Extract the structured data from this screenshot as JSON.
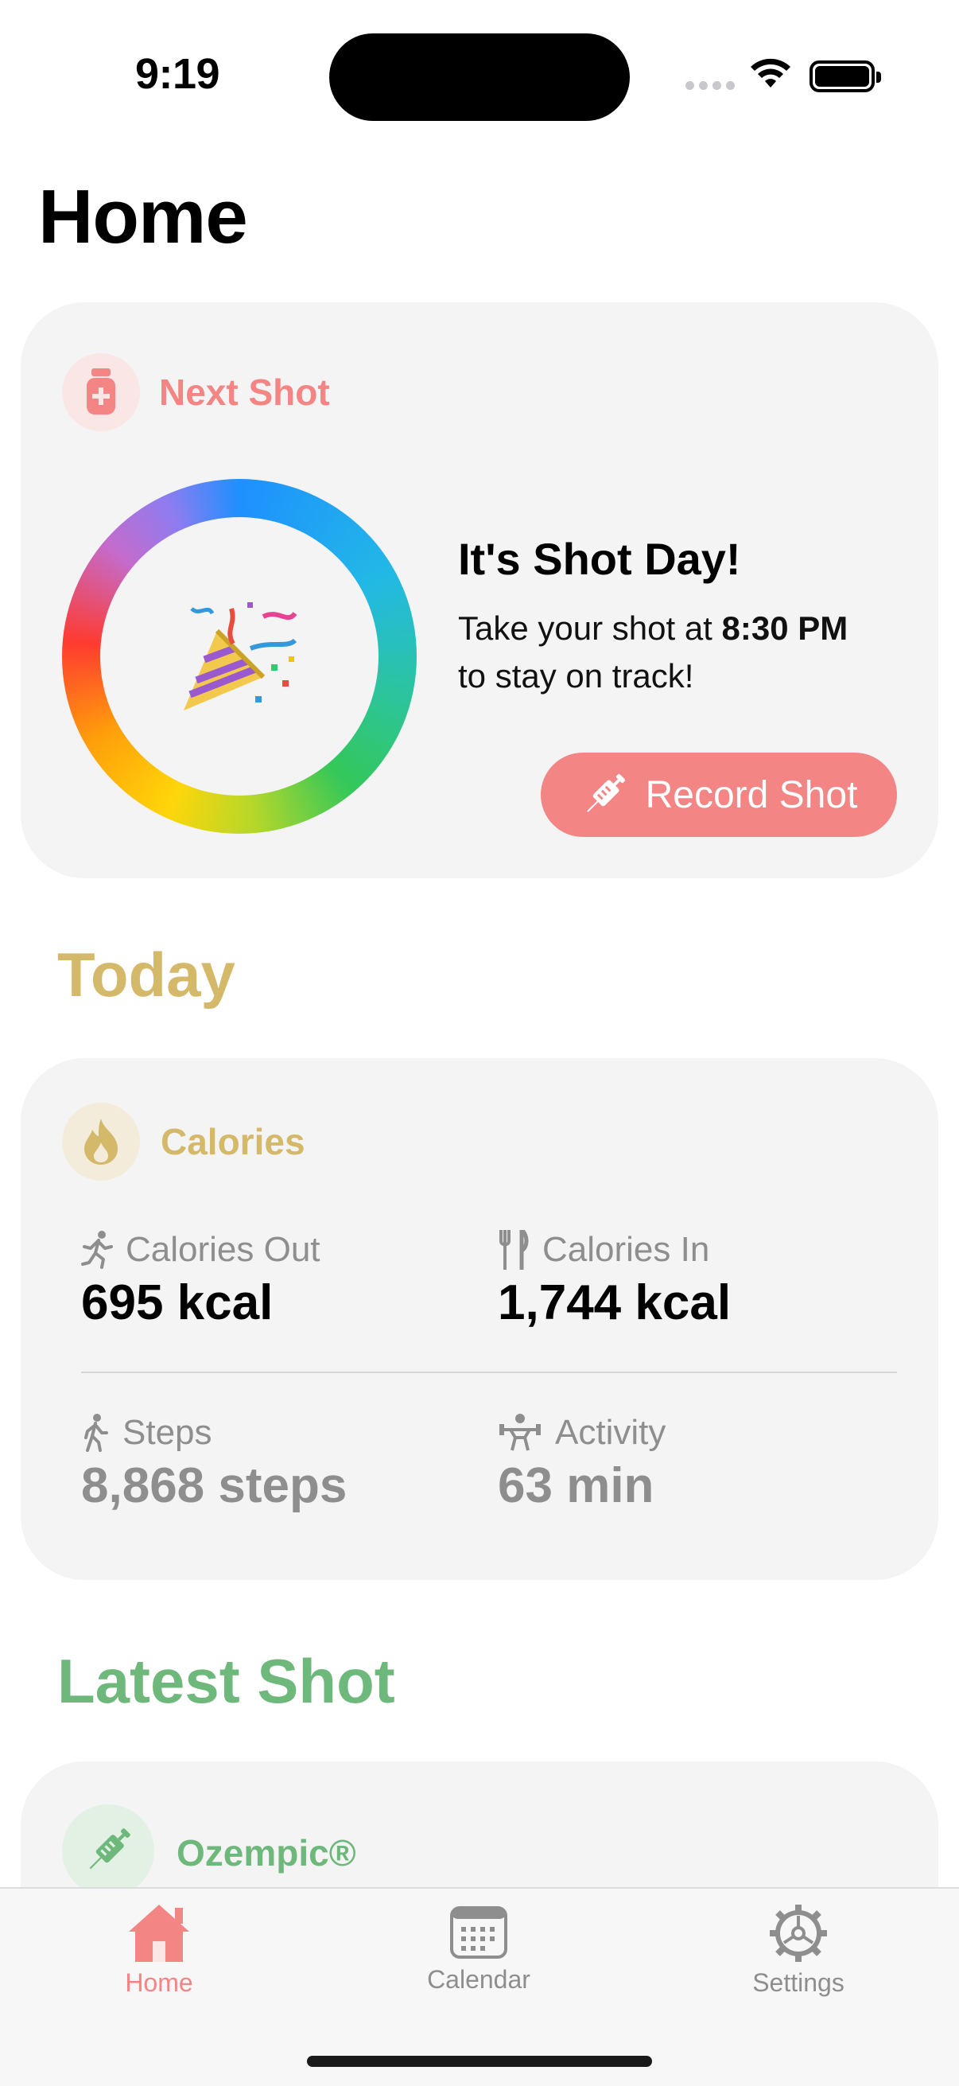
{
  "status_bar": {
    "time": "9:19"
  },
  "page": {
    "title": "Home"
  },
  "next_shot": {
    "badge_icon": "medicine-vial-icon",
    "title": "Next Shot",
    "headline": "It's Shot Day!",
    "text_before": "Take your shot at ",
    "time": "8:30 PM",
    "text_after": "to stay on track!",
    "button_label": "Record Shot",
    "button_icon": "syringe-icon",
    "accent_color": "#f48585"
  },
  "today": {
    "section_title": "Today",
    "card_title": "Calories",
    "badge_icon": "flame-icon",
    "accent_color": "#d4b96a",
    "stats": [
      {
        "label": "Calories Out",
        "value": "695 kcal",
        "icon": "running-icon"
      },
      {
        "label": "Calories In",
        "value": "1,744 kcal",
        "icon": "fork-knife-icon"
      },
      {
        "label": "Steps",
        "value": "8,868 steps",
        "icon": "walking-icon"
      },
      {
        "label": "Activity",
        "value": "63 min",
        "icon": "weightlifting-icon"
      }
    ]
  },
  "latest_shot": {
    "section_title": "Latest Shot",
    "medication": "Ozempic®",
    "badge_icon": "syringe-icon",
    "accent_color": "#6fb87c"
  },
  "tabs": [
    {
      "label": "Home",
      "icon": "house-icon",
      "active": true
    },
    {
      "label": "Calendar",
      "icon": "calendar-icon",
      "active": false
    },
    {
      "label": "Settings",
      "icon": "gear-icon",
      "active": false
    }
  ]
}
